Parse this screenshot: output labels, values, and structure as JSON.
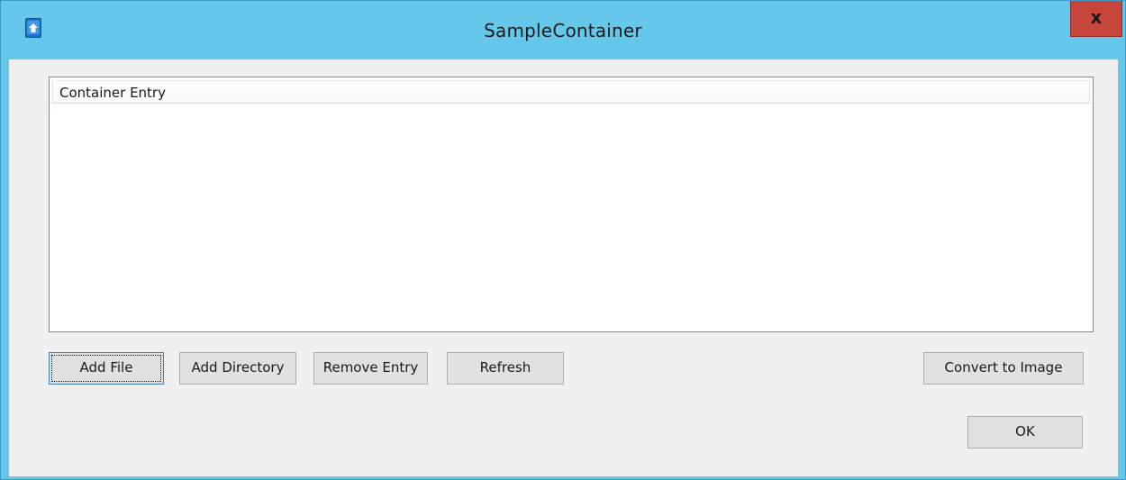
{
  "window": {
    "title": "SampleContainer",
    "close_label": "x"
  },
  "list": {
    "column_header": "Container Entry",
    "rows": []
  },
  "buttons": {
    "add_file": "Add File",
    "add_directory": "Add Directory",
    "remove_entry": "Remove Entry",
    "refresh": "Refresh",
    "convert_to_image": "Convert to Image",
    "ok": "OK"
  },
  "icons": {
    "app": "application-icon",
    "close": "close-icon"
  },
  "colors": {
    "titlebar": "#65c8eb",
    "close_button": "#c7463c",
    "client_background": "#f0f0f0",
    "button_face": "#e1e1e1",
    "focus_border": "#3c7fb1"
  }
}
